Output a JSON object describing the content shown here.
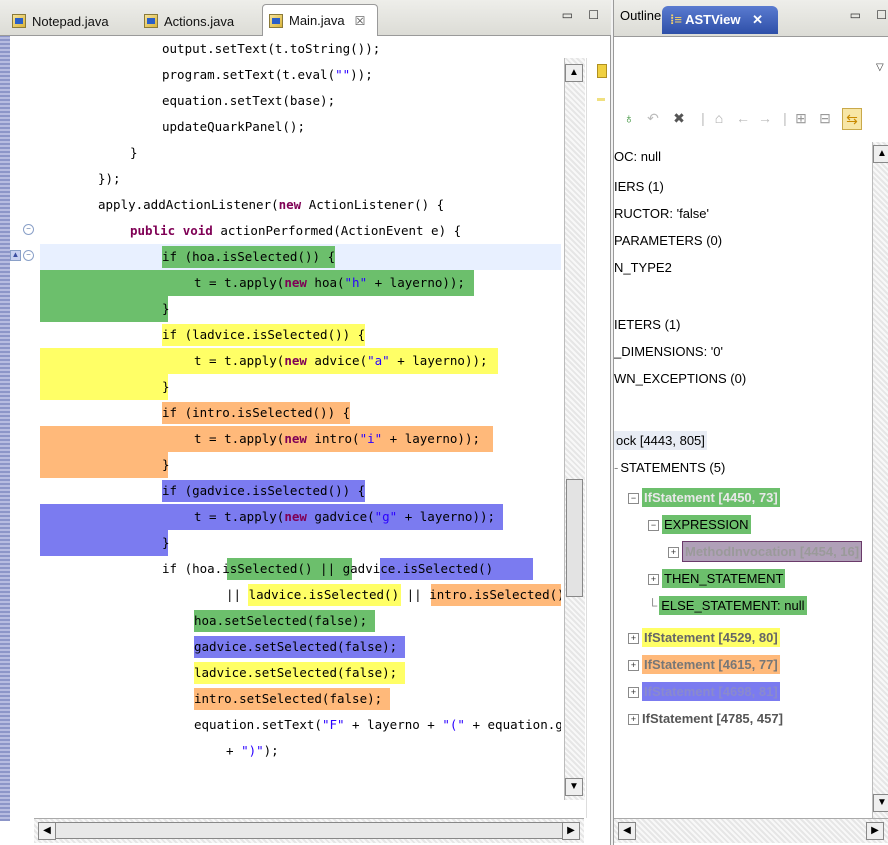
{
  "editor": {
    "tabs": [
      {
        "label": "Notepad.java"
      },
      {
        "label": "Actions.java"
      },
      {
        "label": "Main.java",
        "close": "☒"
      }
    ],
    "window_buttons": "▭ ☐",
    "lines": [
      "output.setText(t.toString());",
      "program.setText(t.eval(\"\"));",
      "equation.setText(base);",
      "updateQuarkPanel();",
      "}",
      "});",
      "apply.addActionListener(new ActionListener() {",
      "public void actionPerformed(ActionEvent e) {",
      "if (hoa.isSelected()) {",
      "t = t.apply(new hoa(\"h\" + layerno));",
      "}",
      "if (ladvice.isSelected()) {",
      "t = t.apply(new advice(\"a\" + layerno));",
      "}",
      "if (intro.isSelected()) {",
      "t = t.apply(new intro(\"i\" + layerno));",
      "}",
      "if (gadvice.isSelected()) {",
      "t = t.apply(new gadvice(\"g\" + layerno));",
      "}",
      "if (hoa.isSelected() || gadvice.isSelected()",
      "|| ladvice.isSelected() || intro.isSelected()",
      "hoa.setSelected(false);",
      "gadvice.setSelected(false);",
      "ladvice.setSelected(false);",
      "intro.setSelected(false);",
      "equation.setText(\"F\" + layerno + \"(\" + equation.g",
      "+ \")\");"
    ]
  },
  "ast_view": {
    "tabs": [
      {
        "label": "Outline"
      },
      {
        "label": "ASTView",
        "close": "✕"
      }
    ],
    "window_buttons": "▭ ☐",
    "menu_arrow": "▽",
    "toolbar_icons": [
      "refresh-icon",
      "back-icon",
      "delete-icon",
      "home-icon",
      "previous-icon",
      "next-icon",
      "expand-all-icon",
      "collapse-all-icon",
      "link-with-editor-icon"
    ],
    "tree": [
      {
        "label": "OC: null"
      },
      {
        "label": "IERS (1)"
      },
      {
        "label": "RUCTOR: 'false'"
      },
      {
        "label": "PARAMETERS (0)"
      },
      {
        "label": "N_TYPE2"
      },
      {
        "label": ""
      },
      {
        "label": "IETERS (1)"
      },
      {
        "label": "_DIMENSIONS: '0'"
      },
      {
        "label": "WN_EXCEPTIONS (0)"
      },
      {
        "label": "ock [4443, 805]"
      },
      {
        "label": "STATEMENTS (5)"
      },
      {
        "label": "IfStatement [4450, 73]"
      },
      {
        "label": "EXPRESSION"
      },
      {
        "label": "MethodInvocation [4454, 16]"
      },
      {
        "label": "THEN_STATEMENT"
      },
      {
        "label": "ELSE_STATEMENT: null"
      },
      {
        "label": "IfStatement [4529, 80]"
      },
      {
        "label": "IfStatement [4615, 77]"
      },
      {
        "label": "IfStatement [4698, 81]"
      },
      {
        "label": "IfStatement [4785, 457]"
      }
    ]
  },
  "colors": {
    "green": "#6cbf6c",
    "yellow": "#ffff66",
    "orange": "#ffb97a",
    "blue": "#7b7bf0",
    "current_line": "#e8f0ff",
    "keyword": "#7f0055",
    "string": "#2a00ff"
  }
}
